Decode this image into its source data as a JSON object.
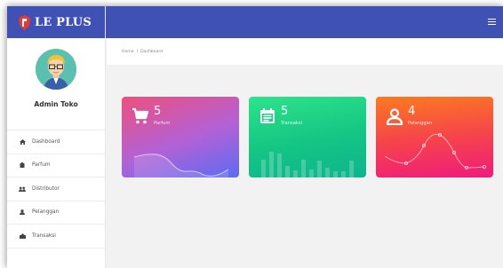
{
  "brand": {
    "name": "LE PLUS"
  },
  "admin": {
    "name": "Admin Toko"
  },
  "menu": [
    {
      "label": "Dashboard",
      "icon": "home-icon"
    },
    {
      "label": "Parfum",
      "icon": "bottle-icon"
    },
    {
      "label": "Distributor",
      "icon": "users-icon"
    },
    {
      "label": "Pelanggan",
      "icon": "user-icon"
    },
    {
      "label": "Transaksi",
      "icon": "receipt-icon"
    }
  ],
  "breadcrumb": {
    "home": "Home",
    "separator": "/",
    "current": "Dashboard"
  },
  "cards": [
    {
      "value": "5",
      "label": "Parfum",
      "icon": "cart-icon",
      "chart": "line",
      "color": "#6b5ff0"
    },
    {
      "value": "5",
      "label": "Transaksi",
      "icon": "calendar-icon",
      "chart": "bar",
      "color": "#1fcf86"
    },
    {
      "value": "4",
      "label": "Pelanggan",
      "icon": "user-icon",
      "chart": "line",
      "color": "#f6454a"
    }
  ],
  "colors": {
    "primary": "#3f51b5"
  }
}
